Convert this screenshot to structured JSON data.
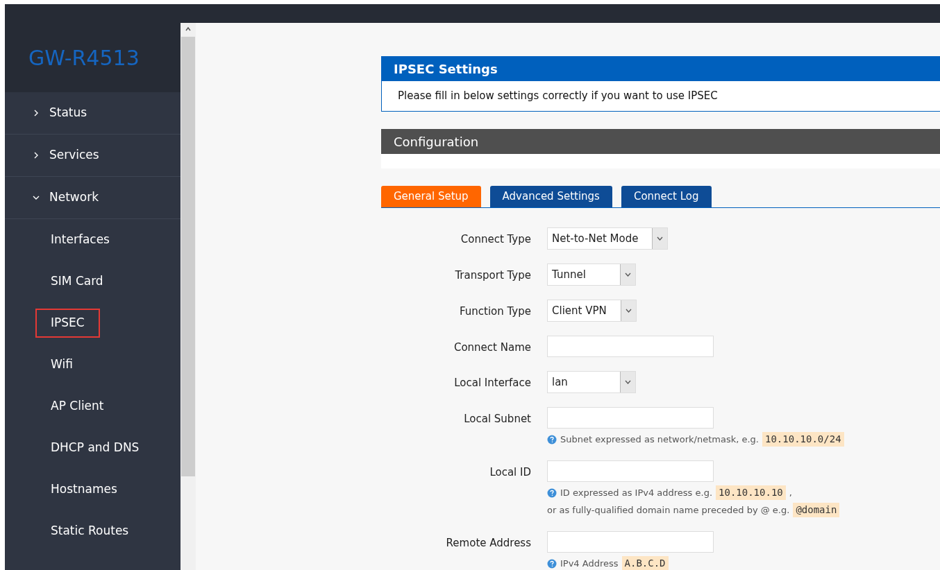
{
  "brand": "GW-R4513",
  "sidebar": {
    "items": [
      {
        "kind": "section",
        "label": "Status",
        "expanded": false
      },
      {
        "kind": "section",
        "label": "Services",
        "expanded": false
      },
      {
        "kind": "section",
        "label": "Network",
        "expanded": true
      },
      {
        "kind": "item",
        "label": "Interfaces",
        "selected": false
      },
      {
        "kind": "item",
        "label": "SIM Card",
        "selected": false
      },
      {
        "kind": "item",
        "label": "IPSEC",
        "selected": true
      },
      {
        "kind": "item",
        "label": "Wifi",
        "selected": false
      },
      {
        "kind": "item",
        "label": "AP Client",
        "selected": false
      },
      {
        "kind": "item",
        "label": "DHCP and DNS",
        "selected": false
      },
      {
        "kind": "item",
        "label": "Hostnames",
        "selected": false
      },
      {
        "kind": "item",
        "label": "Static Routes",
        "selected": false
      }
    ]
  },
  "settings": {
    "title": "IPSEC Settings",
    "description": "Please fill in below settings correctly if you want to use IPSEC"
  },
  "configuration": {
    "title": "Configuration"
  },
  "tabs": [
    {
      "label": "General Setup",
      "selected": true
    },
    {
      "label": "Advanced Settings",
      "selected": false
    },
    {
      "label": "Connect Log",
      "selected": false
    }
  ],
  "fields": [
    {
      "kind": "select",
      "label": "Connect Type",
      "value": "Net-to-Net Mode"
    },
    {
      "kind": "select",
      "label": "Transport Type",
      "value": "Tunnel"
    },
    {
      "kind": "select",
      "label": "Function Type",
      "value": "Client VPN"
    },
    {
      "kind": "text",
      "label": "Connect Name"
    },
    {
      "kind": "select",
      "label": "Local Interface",
      "value": "lan"
    },
    {
      "kind": "text",
      "label": "Local Subnet",
      "hint": [
        [
          {
            "kind": "plain",
            "text": "Subnet expressed as network/netmask, e.g."
          },
          {
            "kind": "code",
            "text": "10.10.10.0/24"
          }
        ]
      ]
    },
    {
      "kind": "text",
      "label": "Local ID",
      "hint": [
        [
          {
            "kind": "plain",
            "text": "ID expressed as IPv4 address e.g."
          },
          {
            "kind": "code",
            "text": "10.10.10.10"
          },
          {
            "kind": "plain",
            "text": ","
          }
        ],
        [
          {
            "kind": "plain",
            "text": "or as fully-qualified domain name preceded by @ e.g."
          },
          {
            "kind": "code",
            "text": "@domain"
          }
        ]
      ]
    },
    {
      "kind": "text",
      "label": "Remote Address",
      "hint": [
        [
          {
            "kind": "plain",
            "text": "IPv4 Address"
          },
          {
            "kind": "code",
            "text": "A.B.C.D"
          }
        ]
      ]
    }
  ]
}
